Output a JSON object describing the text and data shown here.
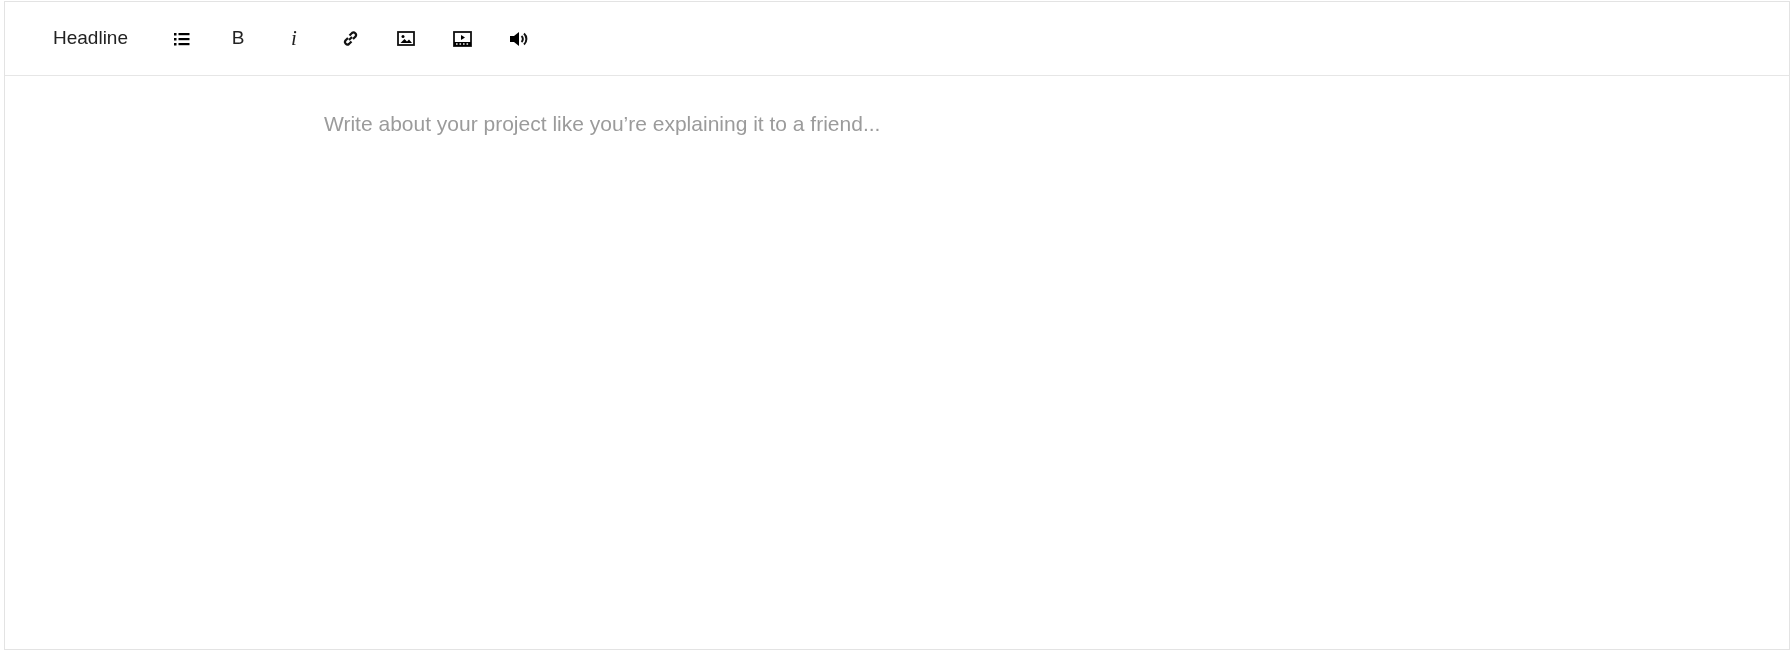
{
  "toolbar": {
    "headline_button": "Headline",
    "bold_button": "B",
    "italic_button": "i"
  },
  "editor": {
    "placeholder": "Write about your project like you’re explaining it to a friend..."
  }
}
